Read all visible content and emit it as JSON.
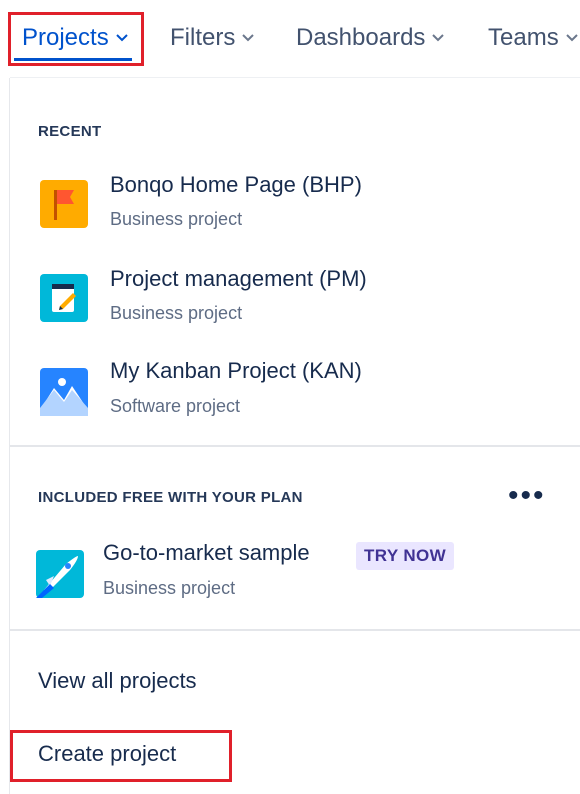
{
  "nav": {
    "items": [
      {
        "label": "Projects"
      },
      {
        "label": "Filters"
      },
      {
        "label": "Dashboards"
      },
      {
        "label": "Teams"
      }
    ]
  },
  "dropdown": {
    "recent_heading": "RECENT",
    "recent": [
      {
        "title": "Bonqo Home Page (BHP)",
        "subtitle": "Business project",
        "icon": "flag-icon"
      },
      {
        "title": "Project management (PM)",
        "subtitle": "Business project",
        "icon": "notepad-icon"
      },
      {
        "title": "My Kanban Project (KAN)",
        "subtitle": "Software project",
        "icon": "mountain-icon"
      }
    ],
    "included_heading": "INCLUDED FREE WITH YOUR PLAN",
    "more_label": "•••",
    "included": [
      {
        "title": "Go-to-market sample",
        "subtitle": "Business project",
        "badge": "TRY NOW",
        "icon": "rocket-icon"
      }
    ],
    "view_all": "View all projects",
    "create": "Create project"
  },
  "colors": {
    "accent": "#0052cc",
    "highlight": "#e0202a",
    "badge_bg": "#eae6ff",
    "badge_text": "#403294"
  }
}
